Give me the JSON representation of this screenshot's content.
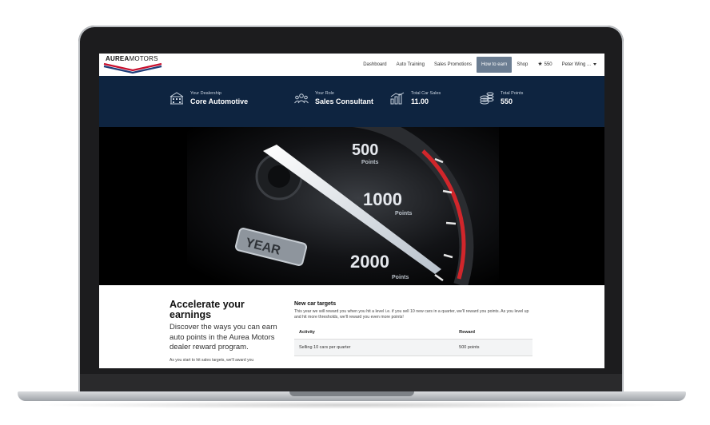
{
  "brand": {
    "logo_text_bold": "AUREA",
    "logo_text_thin": "MOTORS"
  },
  "nav": {
    "items": [
      {
        "label": "Dashboard",
        "active": false
      },
      {
        "label": "Auto Training",
        "active": false
      },
      {
        "label": "Sales Promotions",
        "active": false
      },
      {
        "label": "How to earn",
        "active": true
      },
      {
        "label": "Shop",
        "active": false
      }
    ],
    "points": "550",
    "user": "Peter Wing ..."
  },
  "stats": [
    {
      "label": "Your Dealership",
      "value": "Core Automotive",
      "icon": "building-icon"
    },
    {
      "label": "Your Role",
      "value": "Sales Consultant",
      "icon": "team-icon"
    },
    {
      "label": "Total Car Sales",
      "value": "11.00",
      "icon": "chart-icon"
    },
    {
      "label": "Total Points",
      "value": "550",
      "icon": "coins-icon"
    }
  ],
  "hero": {
    "gauge_labels": [
      {
        "value": "500",
        "unit": "Points"
      },
      {
        "value": "1000",
        "unit": "Points"
      },
      {
        "value": "2000",
        "unit": "Points"
      }
    ],
    "plate_text": "YEAR"
  },
  "content": {
    "title": "Accelerate your earnings",
    "lead": "Discover the ways you can earn auto points in the Aurea Motors dealer reward program.",
    "small": "As you start to hit sales targets, we'll award you",
    "section_title": "New car targets",
    "section_text": "This year we will reward you when you hit a level i.e. if you sell 10 new cars in a quarter, we'll reward you points.  As you level up and hit more thresholds, we'll reward you even more points!",
    "table": {
      "headers": [
        "Activity",
        "Reward"
      ],
      "rows": [
        [
          "Selling 10 cars per quarter",
          "500 points"
        ]
      ]
    }
  },
  "colors": {
    "navy": "#0e2440",
    "active_nav": "#6b7d92",
    "logo_red": "#c8102e",
    "logo_blue": "#1f3e7a"
  }
}
